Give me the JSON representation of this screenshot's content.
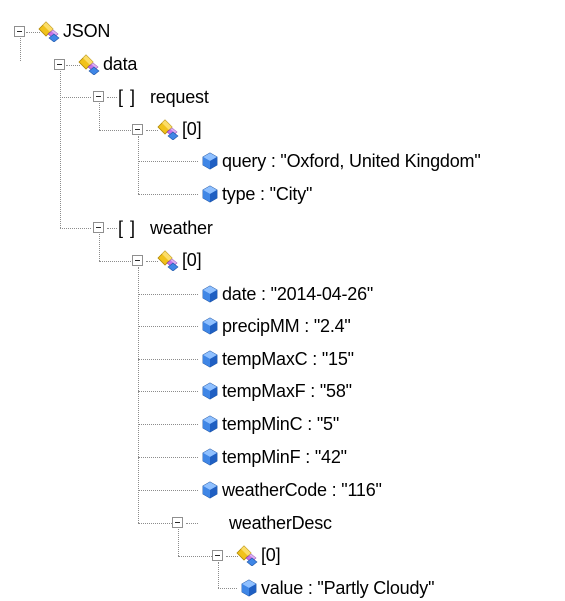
{
  "tree": {
    "root": {
      "label": "JSON",
      "icon": "object-icon"
    },
    "nodes": [
      {
        "id": "data",
        "depth": 1,
        "kind": "object",
        "label": "data",
        "icon": "object-icon"
      },
      {
        "id": "request",
        "depth": 2,
        "kind": "array",
        "label": "request",
        "glyph": "[ ]"
      },
      {
        "id": "request-0",
        "depth": 3,
        "kind": "object",
        "label": "[0]",
        "icon": "object-icon"
      },
      {
        "id": "query",
        "depth": 4,
        "kind": "value",
        "label": "query : \"Oxford, United Kingdom\"",
        "icon": "value-icon"
      },
      {
        "id": "type",
        "depth": 4,
        "kind": "value",
        "label": "type : \"City\"",
        "icon": "value-icon"
      },
      {
        "id": "weather",
        "depth": 2,
        "kind": "array",
        "label": "weather",
        "glyph": "[ ]"
      },
      {
        "id": "weather-0",
        "depth": 3,
        "kind": "object",
        "label": "[0]",
        "icon": "object-icon"
      },
      {
        "id": "date",
        "depth": 4,
        "kind": "value",
        "label": "date : \"2014-04-26\"",
        "icon": "value-icon"
      },
      {
        "id": "precipMM",
        "depth": 4,
        "kind": "value",
        "label": "precipMM : \"2.4\"",
        "icon": "value-icon"
      },
      {
        "id": "tempMaxC",
        "depth": 4,
        "kind": "value",
        "label": "tempMaxC : \"15\"",
        "icon": "value-icon"
      },
      {
        "id": "tempMaxF",
        "depth": 4,
        "kind": "value",
        "label": "tempMaxF : \"58\"",
        "icon": "value-icon"
      },
      {
        "id": "tempMinC",
        "depth": 4,
        "kind": "value",
        "label": "tempMinC : \"5\"",
        "icon": "value-icon"
      },
      {
        "id": "tempMinF",
        "depth": 4,
        "kind": "value",
        "label": "tempMinF : \"42\"",
        "icon": "value-icon"
      },
      {
        "id": "weatherCode",
        "depth": 4,
        "kind": "value",
        "label": "weatherCode : \"116\"",
        "icon": "value-icon"
      },
      {
        "id": "weatherDesc",
        "depth": 4,
        "kind": "array",
        "label": "weatherDesc",
        "glyph": "[ ]"
      },
      {
        "id": "weatherDesc-0",
        "depth": 5,
        "kind": "object",
        "label": "[0]",
        "icon": "object-icon"
      },
      {
        "id": "value",
        "depth": 6,
        "kind": "value",
        "label": "value : \"Partly Cloudy\"",
        "icon": "value-icon"
      }
    ]
  },
  "colors": {
    "object_icon_gold": "#f1c21b",
    "object_icon_violet": "#c474e8",
    "object_icon_blue": "#3f86e6",
    "value_icon_blue": "#2b6fd6",
    "tree_lines": "#8c8c8c"
  }
}
